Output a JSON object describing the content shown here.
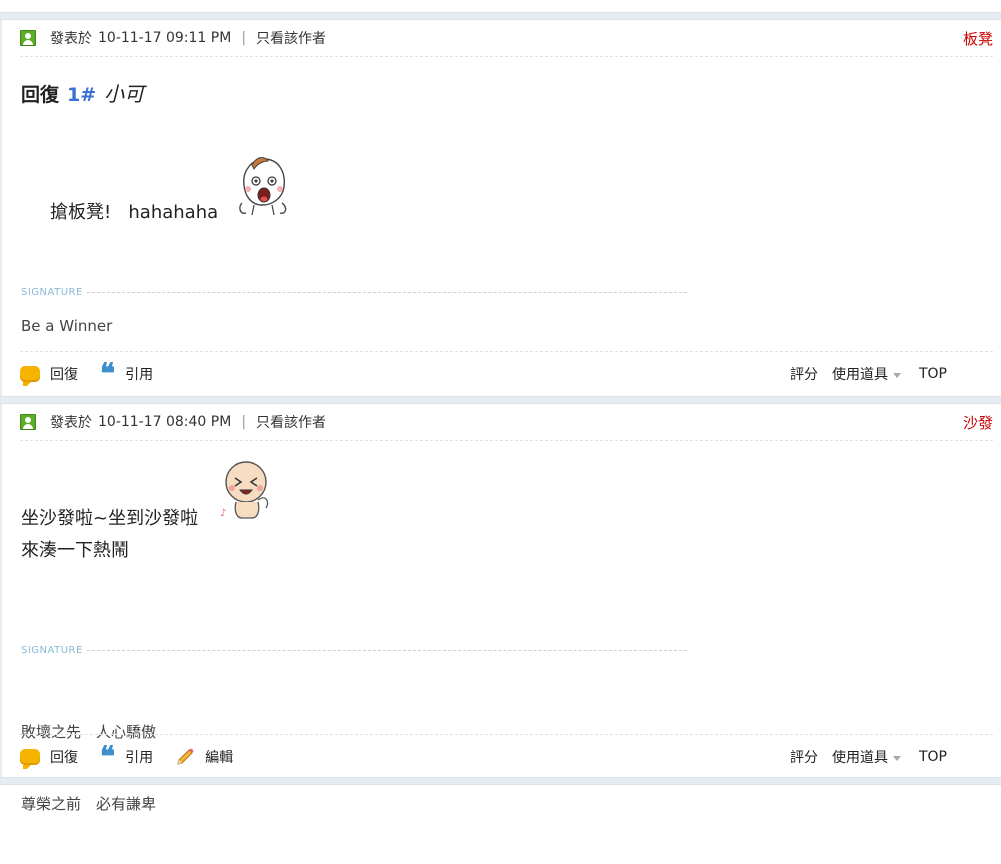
{
  "posts": [
    {
      "meta": {
        "posted_prefix": "發表於",
        "datetime": "10-11-17 09:11 PM",
        "separator": "|",
        "only_author": "只看該作者",
        "floor_name": "板凳"
      },
      "reply_title": {
        "prefix": "回復",
        "floor_ref": "1#",
        "user": "小可"
      },
      "content_lines": [
        "搶板凳!   hahahaha"
      ],
      "signature_label": "SIGNATURE",
      "signature_lines": [
        "Be a Winner"
      ],
      "footer": {
        "reply": "回復",
        "quote": "引用",
        "rate": "評分",
        "use_item": "使用道具",
        "top": "TOP"
      }
    },
    {
      "meta": {
        "posted_prefix": "發表於",
        "datetime": "10-11-17 08:40 PM",
        "separator": "|",
        "only_author": "只看該作者",
        "floor_name": "沙發"
      },
      "content_lines": [
        "坐沙發啦~坐到沙發啦",
        "來湊一下熱鬧"
      ],
      "signature_label": "SIGNATURE",
      "signature_lines": [
        "敗壞之先　人心驕傲",
        "尊榮之前　必有謙卑"
      ],
      "footer": {
        "reply": "回復",
        "quote": "引用",
        "edit": "編輯",
        "rate": "評分",
        "use_item": "使用道具",
        "top": "TOP"
      }
    }
  ],
  "icons": {
    "user": "user-online-icon",
    "reply": "speech-bubble-icon",
    "quote": "quote-icon",
    "edit": "pencil-icon",
    "emote1": "shouting-onion-emoticon",
    "emote2": "laughing-bun-emoticon"
  },
  "colors": {
    "floor_name": "#cc0000",
    "floor_link": "#3b6fd4",
    "signature_label": "#8ab9d6",
    "separator_bar": "#e5edf2"
  }
}
